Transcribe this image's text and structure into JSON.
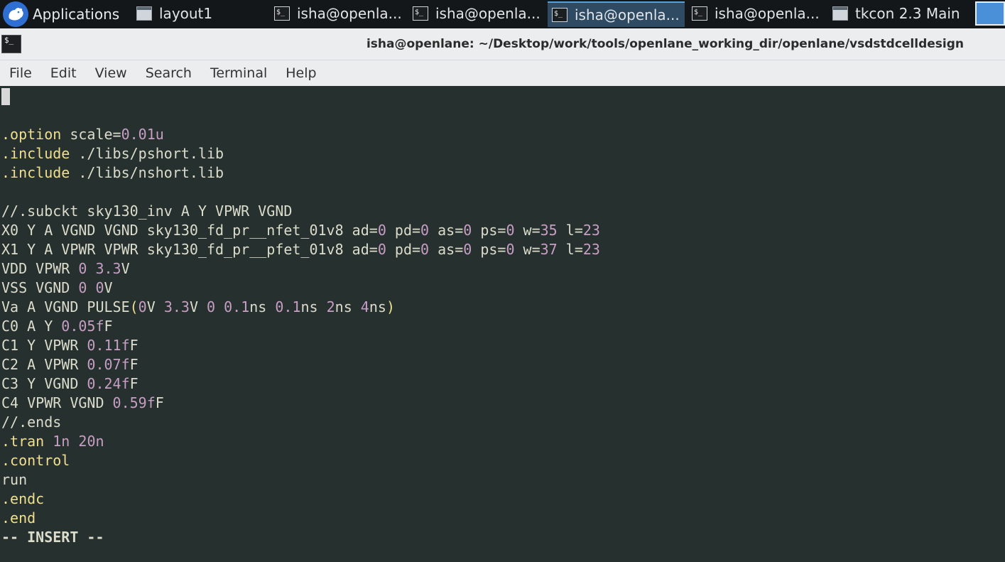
{
  "taskbar": {
    "applications_label": "Applications",
    "tasks": [
      {
        "label": "layout1",
        "type": "window"
      },
      {
        "label": "isha@openla...",
        "type": "terminal"
      },
      {
        "label": "isha@openla...",
        "type": "terminal"
      },
      {
        "label": "isha@openla...",
        "type": "terminal",
        "active": true
      },
      {
        "label": "isha@openla...",
        "type": "terminal"
      },
      {
        "label": "tkcon 2.3 Main",
        "type": "window"
      }
    ]
  },
  "window": {
    "title": "isha@openlane: ~/Desktop/work/tools/openlane_working_dir/openlane/vsdstdcelldesign"
  },
  "menu": [
    "File",
    "Edit",
    "View",
    "Search",
    "Terminal",
    "Help"
  ],
  "editor": {
    "lines": [
      [
        {
          "t": ".option",
          "c": "kw"
        },
        {
          "t": " scale="
        },
        {
          "t": "0.01u",
          "c": "num"
        }
      ],
      [
        {
          "t": ".include",
          "c": "kw"
        },
        {
          "t": " ./libs/pshort.lib"
        }
      ],
      [
        {
          "t": ".include",
          "c": "kw"
        },
        {
          "t": " ./libs/nshort.lib"
        }
      ],
      [],
      [
        {
          "t": "//.subckt sky130_inv A Y VPWR VGND"
        }
      ],
      [
        {
          "t": "X0 Y A VGND VGND sky130_fd_pr__nfet_01v8 ad="
        },
        {
          "t": "0",
          "c": "num"
        },
        {
          "t": " pd="
        },
        {
          "t": "0",
          "c": "num"
        },
        {
          "t": " as="
        },
        {
          "t": "0",
          "c": "num"
        },
        {
          "t": " ps="
        },
        {
          "t": "0",
          "c": "num"
        },
        {
          "t": " w="
        },
        {
          "t": "35",
          "c": "num"
        },
        {
          "t": " l="
        },
        {
          "t": "23",
          "c": "num"
        }
      ],
      [
        {
          "t": "X1 Y A VPWR VPWR sky130_fd_pr__pfet_01v8 ad="
        },
        {
          "t": "0",
          "c": "num"
        },
        {
          "t": " pd="
        },
        {
          "t": "0",
          "c": "num"
        },
        {
          "t": " as="
        },
        {
          "t": "0",
          "c": "num"
        },
        {
          "t": " ps="
        },
        {
          "t": "0",
          "c": "num"
        },
        {
          "t": " w="
        },
        {
          "t": "37",
          "c": "num"
        },
        {
          "t": " l="
        },
        {
          "t": "23",
          "c": "num"
        }
      ],
      [
        {
          "t": "VDD VPWR "
        },
        {
          "t": "0",
          "c": "num"
        },
        {
          "t": " "
        },
        {
          "t": "3.3",
          "c": "num"
        },
        {
          "t": "V"
        }
      ],
      [
        {
          "t": "VSS VGND "
        },
        {
          "t": "0",
          "c": "num"
        },
        {
          "t": " "
        },
        {
          "t": "0",
          "c": "num"
        },
        {
          "t": "V"
        }
      ],
      [
        {
          "t": "Va A VGND PULSE"
        },
        {
          "t": "(",
          "c": "par"
        },
        {
          "t": "0",
          "c": "num"
        },
        {
          "t": "V "
        },
        {
          "t": "3.3",
          "c": "num"
        },
        {
          "t": "V "
        },
        {
          "t": "0",
          "c": "num"
        },
        {
          "t": " "
        },
        {
          "t": "0.1",
          "c": "num"
        },
        {
          "t": "ns "
        },
        {
          "t": "0.1",
          "c": "num"
        },
        {
          "t": "ns "
        },
        {
          "t": "2",
          "c": "num"
        },
        {
          "t": "ns "
        },
        {
          "t": "4",
          "c": "num"
        },
        {
          "t": "ns"
        },
        {
          "t": ")",
          "c": "par"
        }
      ],
      [
        {
          "t": "C0 A Y "
        },
        {
          "t": "0.05f",
          "c": "num"
        },
        {
          "t": "F"
        }
      ],
      [
        {
          "t": "C1 Y VPWR "
        },
        {
          "t": "0.11f",
          "c": "num"
        },
        {
          "t": "F"
        }
      ],
      [
        {
          "t": "C2 A VPWR "
        },
        {
          "t": "0.07f",
          "c": "num"
        },
        {
          "t": "F"
        }
      ],
      [
        {
          "t": "C3 Y VGND "
        },
        {
          "t": "0.24f",
          "c": "num"
        },
        {
          "t": "F"
        }
      ],
      [
        {
          "t": "C4 VPWR VGND "
        },
        {
          "t": "0.59f",
          "c": "num"
        },
        {
          "t": "F"
        }
      ],
      [
        {
          "t": "//.ends"
        }
      ],
      [
        {
          "t": ".tran",
          "c": "kw"
        },
        {
          "t": " "
        },
        {
          "t": "1n",
          "c": "num"
        },
        {
          "t": " "
        },
        {
          "t": "20n",
          "c": "num"
        }
      ],
      [
        {
          "t": ".control",
          "c": "kw"
        }
      ],
      [
        {
          "t": "run"
        }
      ],
      [
        {
          "t": ".endc",
          "c": "kw"
        }
      ],
      [
        {
          "t": ".end",
          "c": "kw"
        }
      ]
    ],
    "mode": "-- INSERT --"
  }
}
